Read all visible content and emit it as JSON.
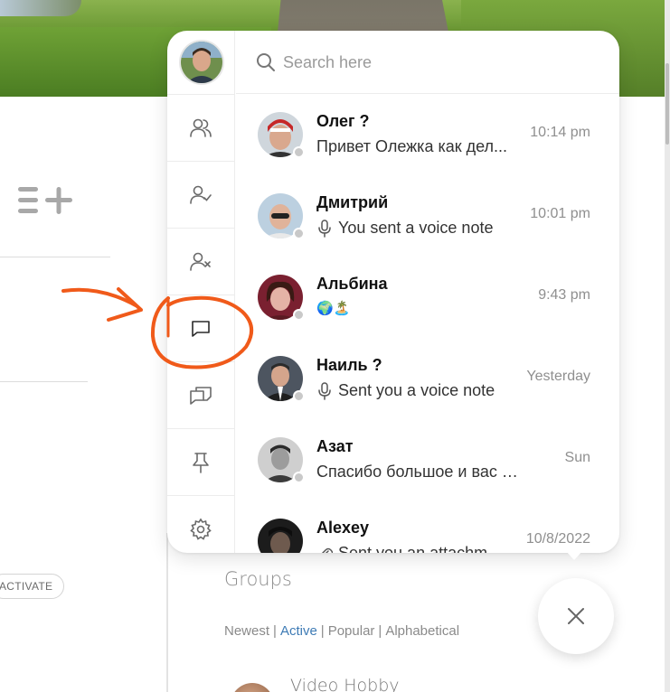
{
  "search": {
    "placeholder": "Search here"
  },
  "sidebar": {
    "items": [
      {
        "icon": "friends-icon"
      },
      {
        "icon": "friends-accepted-icon"
      },
      {
        "icon": "friends-blocked-icon"
      },
      {
        "icon": "messages-icon"
      },
      {
        "icon": "group-chats-icon"
      },
      {
        "icon": "pin-icon"
      },
      {
        "icon": "settings-icon"
      }
    ]
  },
  "conversations": [
    {
      "name": "Олег ?",
      "preview": "Привет Олежка как дел...",
      "time": "10:14 pm",
      "type": "text"
    },
    {
      "name": "Дмитрий",
      "preview": "You sent a voice note",
      "time": "10:01 pm",
      "type": "voice"
    },
    {
      "name": "Альбина",
      "preview": "🌍🏝️",
      "time": "9:43 pm",
      "type": "text"
    },
    {
      "name": "Наиль ?",
      "preview": "Sent you a voice note",
      "time": "Yesterday",
      "type": "voice"
    },
    {
      "name": "Азат",
      "preview": "Спасибо большое и вас с Но...",
      "time": "Sun",
      "type": "text"
    },
    {
      "name": "Alexey",
      "preview": "Sent you an attachm...",
      "time": "10/8/2022",
      "type": "attachment"
    }
  ],
  "background": {
    "activate_label": "ACTIVATE",
    "groups_title": "Groups",
    "group_filters": [
      "Newest",
      "Active",
      "Popular",
      "Alphabetical"
    ],
    "active_filter": "Active",
    "group_item_name": "Video Hobby"
  },
  "colors": {
    "accent_link": "#3e7bb5",
    "annotation": "#f05a1a",
    "online_dot": "#c9c9c9"
  }
}
